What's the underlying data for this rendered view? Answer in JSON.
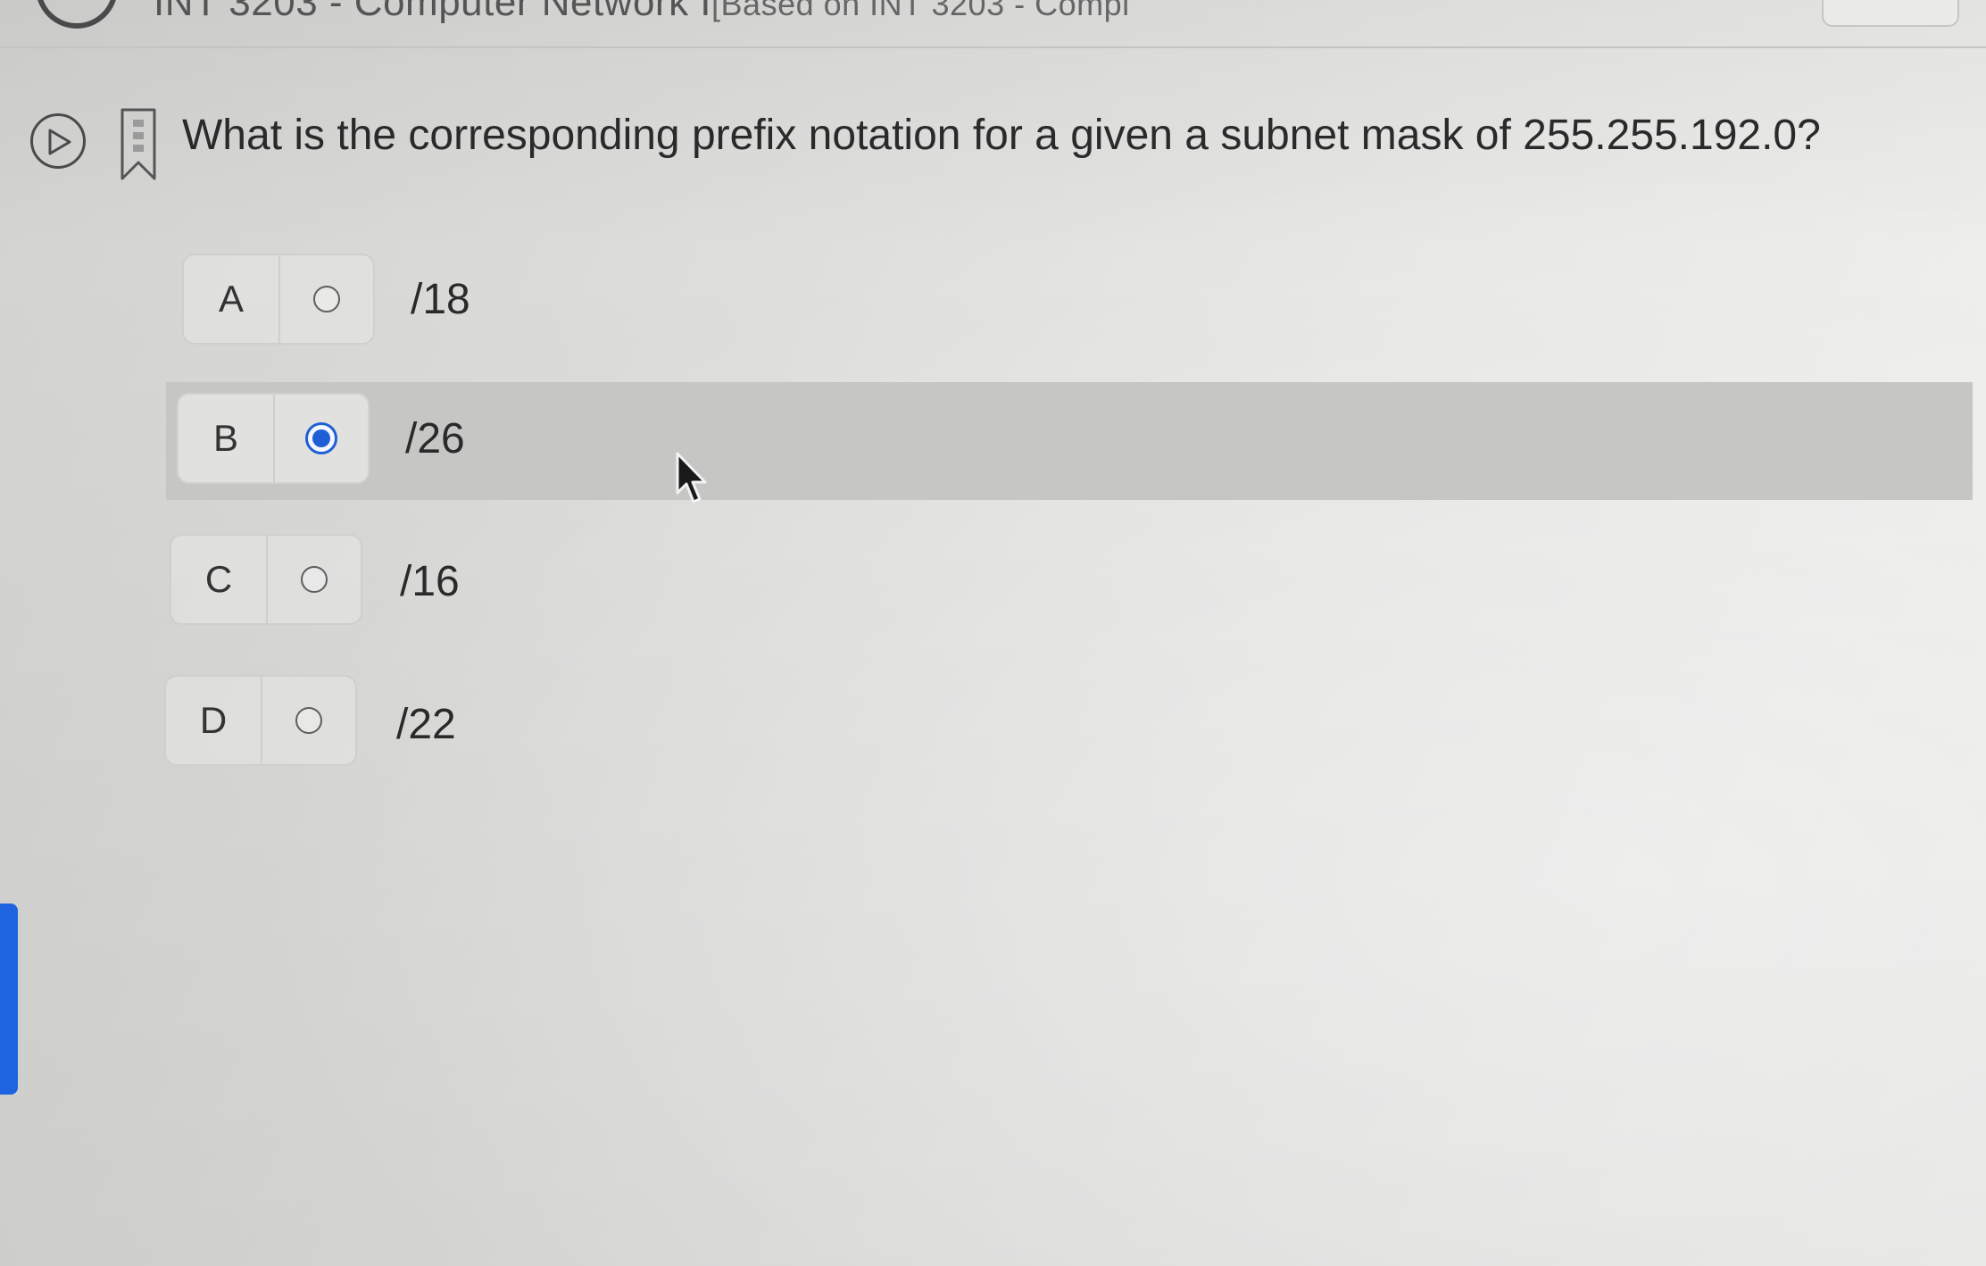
{
  "header": {
    "course_title": "INT 3203 - Computer Network I",
    "course_subtitle": "[Based on INT 3203 - Compl"
  },
  "question": {
    "play_icon": "play-icon",
    "bookmark_icon": "bookmark-icon",
    "text": "What is the corresponding prefix notation for a given a subnet mask of 255.255.192.0?"
  },
  "options": [
    {
      "letter": "A",
      "text": "/18",
      "selected": false
    },
    {
      "letter": "B",
      "text": "/26",
      "selected": true
    },
    {
      "letter": "C",
      "text": "/16",
      "selected": false
    },
    {
      "letter": "D",
      "text": "/22",
      "selected": false
    }
  ],
  "colors": {
    "radio_selected": "#1f5fd6",
    "selected_row": "#c6c6c4",
    "left_accent": "#1e63e0"
  }
}
